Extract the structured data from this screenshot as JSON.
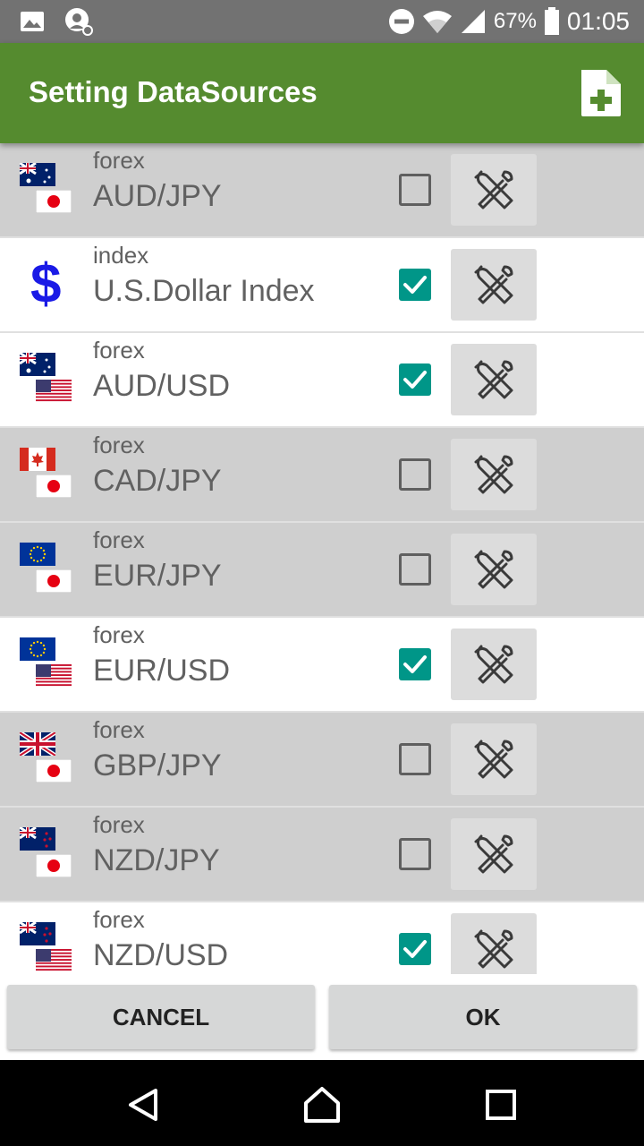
{
  "status_bar": {
    "battery_percent": "67%",
    "time": "01:05",
    "icons": [
      "image-icon",
      "cast-icon",
      "do-not-disturb-icon",
      "wifi-icon",
      "signal-icon",
      "battery-icon"
    ]
  },
  "app_bar": {
    "title": "Setting DataSources",
    "action_icon": "add-file-icon"
  },
  "colors": {
    "app_bar": "#558b2f",
    "checkbox_checked": "#009688",
    "row_unchecked_bg": "#cfcfcf",
    "row_checked_bg": "#ffffff"
  },
  "rows": [
    {
      "category": "forex",
      "name": "AUD/JPY",
      "checked": false,
      "flags": [
        "au",
        "jp"
      ]
    },
    {
      "category": "index",
      "name": "U.S.Dollar Index",
      "checked": true,
      "flags": [
        "dollar"
      ]
    },
    {
      "category": "forex",
      "name": "AUD/USD",
      "checked": true,
      "flags": [
        "au",
        "us"
      ]
    },
    {
      "category": "forex",
      "name": "CAD/JPY",
      "checked": false,
      "flags": [
        "ca",
        "jp"
      ]
    },
    {
      "category": "forex",
      "name": "EUR/JPY",
      "checked": false,
      "flags": [
        "eu",
        "jp"
      ]
    },
    {
      "category": "forex",
      "name": "EUR/USD",
      "checked": true,
      "flags": [
        "eu",
        "us"
      ]
    },
    {
      "category": "forex",
      "name": "GBP/JPY",
      "checked": false,
      "flags": [
        "gb",
        "jp"
      ]
    },
    {
      "category": "forex",
      "name": "NZD/JPY",
      "checked": false,
      "flags": [
        "nz",
        "jp"
      ]
    },
    {
      "category": "forex",
      "name": "NZD/USD",
      "checked": true,
      "flags": [
        "nz",
        "us"
      ]
    }
  ],
  "buttons": {
    "cancel": "CANCEL",
    "ok": "OK"
  },
  "nav_bar": {
    "icons": [
      "back-icon",
      "home-icon",
      "recents-icon"
    ]
  }
}
